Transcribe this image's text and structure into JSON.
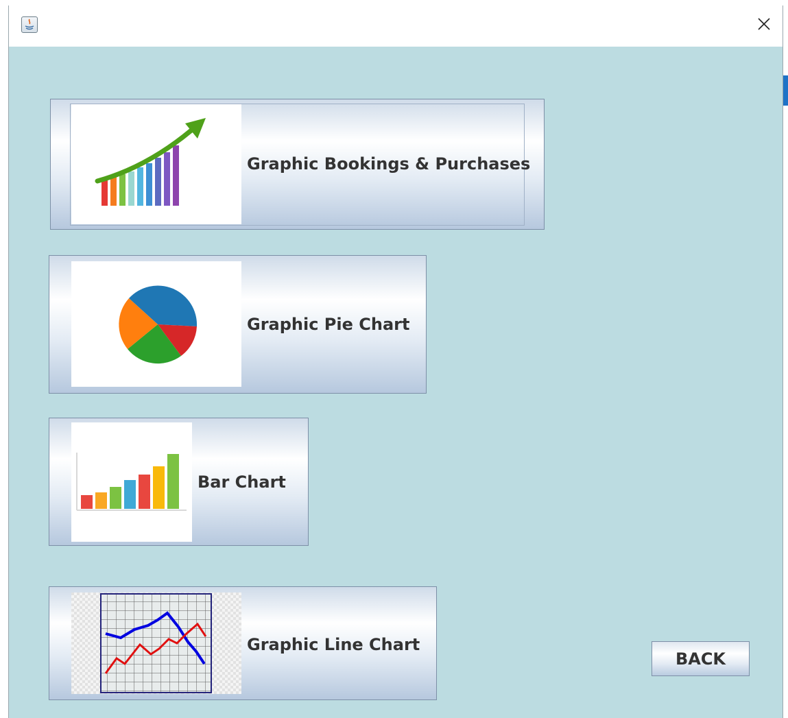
{
  "window": {
    "background": "#bcdce1",
    "close_icon_glyph": "✕"
  },
  "buttons": {
    "bookings": {
      "label": "Graphic Bookings & Purchases",
      "icon": "growth-chart-icon"
    },
    "pie": {
      "label": "Graphic Pie Chart",
      "icon": "pie-chart-icon"
    },
    "bar": {
      "label": "Bar Chart",
      "icon": "bar-chart-icon"
    },
    "line": {
      "label": "Graphic Line Chart",
      "icon": "line-chart-icon"
    },
    "back": {
      "label": "BACK"
    }
  },
  "colors": {
    "pie_blue": "#1f77b4",
    "pie_orange": "#ff7f0e",
    "pie_green": "#2ca02c",
    "pie_red": "#d62728",
    "arrow_green": "#4fa11a",
    "line_blue": "#0000e0",
    "line_red": "#e01010"
  }
}
